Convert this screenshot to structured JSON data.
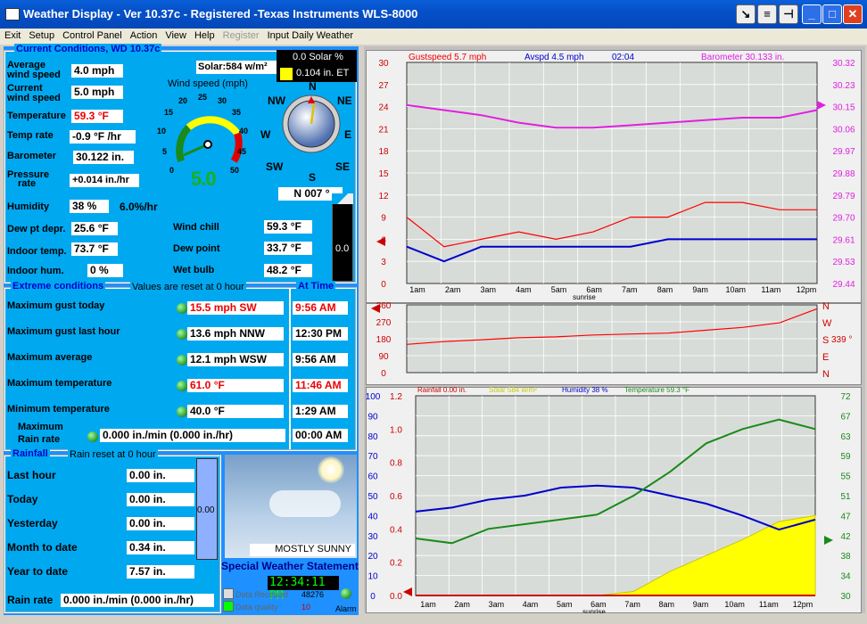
{
  "window": {
    "title": "Weather Display - Ver 10.37c - Registered  -Texas Instruments WLS-8000"
  },
  "menu": [
    {
      "l": "Exit",
      "d": false
    },
    {
      "l": "Setup",
      "d": false
    },
    {
      "l": "Control Panel",
      "d": false
    },
    {
      "l": "Action",
      "d": false
    },
    {
      "l": "View",
      "d": false
    },
    {
      "l": "Help",
      "d": false
    },
    {
      "l": "Register",
      "d": true
    },
    {
      "l": "Input Daily Weather",
      "d": false
    }
  ],
  "current": {
    "title": "Current Conditions, WD 10.37c",
    "avg_wind_label1": "Average",
    "avg_wind_label2": "wind speed",
    "avg_wind": "4.0 mph",
    "cur_wind_label1": "Current",
    "cur_wind_label2": "wind speed",
    "cur_wind": "5.0 mph",
    "temp_label": "Temperature",
    "temp": "59.3 °F",
    "temp_rate_label": "Temp rate",
    "temp_rate": "-0.9 °F /hr",
    "baro_label": "Barometer",
    "baro": "30.122 in.",
    "press_rate_label1": "Pressure",
    "press_rate_label2": "rate",
    "press_rate": "+0.014 in./hr",
    "humidity_label": "Humidity",
    "humidity": "38 %",
    "humidity_rate": "6.0%/hr",
    "dew_depr_label": "Dew pt depr.",
    "dew_depr": "25.6 °F",
    "indoor_temp_label": "Indoor temp.",
    "indoor_temp": "73.7 °F",
    "indoor_hum_label": "Indoor hum.",
    "indoor_hum": "0 %",
    "wind_chill_label": "Wind chill",
    "wind_chill": "59.3 °F",
    "dew_point_label": "Dew point",
    "dew_point": "33.7 °F",
    "wet_bulb_label": "Wet bulb",
    "wet_bulb": "48.2 °F",
    "solar": "Solar:584 w/m²",
    "solar_pct": "0.0 Solar %",
    "et": "0.104 in. ET",
    "wind_gauge_title": "Wind speed (mph)",
    "wind_gauge_ticks": [
      "0",
      "5",
      "10",
      "15",
      "20",
      "25",
      "30",
      "35",
      "40",
      "45",
      "50"
    ],
    "wind_gauge_value": "5.0",
    "compass": {
      "N": "N",
      "NE": "NE",
      "E": "E",
      "SE": "SE",
      "S": "S",
      "SW": "SW",
      "W": "W",
      "NW": "NW"
    },
    "wind_dir": "N  007 °",
    "meter_value": "0.0"
  },
  "extreme": {
    "title": "Extreme conditions",
    "note": "Values are reset at 0 hour",
    "at_time": "At Time",
    "rows": [
      {
        "label": "Maximum gust today",
        "value": "15.5 mph  SW",
        "time": "9:56 AM",
        "red": true
      },
      {
        "label": "Maximum gust last hour",
        "value": "13.6 mph NNW",
        "time": "12:30 PM",
        "red": false
      },
      {
        "label": "Maximum average",
        "value": "12.1 mph WSW",
        "time": "9:56 AM",
        "red": false
      },
      {
        "label": "Maximum temperature",
        "value": "61.0 °F",
        "time": "11:46 AM",
        "red": true
      },
      {
        "label": "Minimum temperature",
        "value": "40.0 °F",
        "time": "1:29 AM",
        "red": false
      }
    ],
    "max_rain_label1": "Maximum",
    "max_rain_label2": "Rain rate",
    "max_rain": "0.000 in./min (0.000 in./hr)",
    "max_rain_time": "00:00 AM"
  },
  "rainfall": {
    "title": "Rainfall",
    "note": "Rain reset at 0 hour",
    "rows": [
      {
        "label": "Last hour",
        "value": "0.00 in."
      },
      {
        "label": "Today",
        "value": "0.00 in."
      },
      {
        "label": "Yesterday",
        "value": "0.00 in."
      },
      {
        "label": "Month to date",
        "value": "0.34 in."
      },
      {
        "label": "Year to date",
        "value": "7.57 in."
      }
    ],
    "gauge_value": "0.00",
    "rate_label": "Rain rate",
    "rate": "0.000 in./min (0.000 in./hr)"
  },
  "sky": {
    "condition": "MOSTLY SUNNY",
    "statement": "Special Weather Statement",
    "time": "12:34:11 PM",
    "data_received_label": "Data Received",
    "data_received": "48276",
    "data_quality_label": "Data quality",
    "data_quality": "10",
    "alarm": "Alarm"
  },
  "x_ticks": [
    "1am",
    "2am",
    "3am",
    "4am",
    "5am",
    "6am",
    "7am",
    "8am",
    "9am",
    "10am",
    "11am",
    "12pm"
  ],
  "sunrise": "sunrise",
  "graph1": {
    "gust_label": "Gustspeed 5.7 mph",
    "avspd_label": "Avspd 4.5 mph",
    "time": "02:04",
    "baro_label": "Barometer    30.133 in.",
    "left_ticks": [
      "30",
      "27",
      "24",
      "21",
      "18",
      "15",
      "12",
      "9",
      "6",
      "3",
      "0"
    ],
    "right_ticks": [
      "30.32",
      "30.23",
      "30.15",
      "30.06",
      "29.97",
      "29.88",
      "29.79",
      "29.70",
      "29.61",
      "29.53",
      "29.44"
    ]
  },
  "graph2": {
    "left_ticks": [
      "360",
      "270",
      "180",
      "90",
      "0"
    ],
    "right_letters": [
      "N",
      "W",
      "S",
      "E",
      "N"
    ],
    "dir_label": "339 °"
  },
  "graph3": {
    "rain_label": "Rainfall   0.00 in.",
    "solar_label": "Solar  584 w/m²",
    "hum_label": "Humidity  38 %",
    "temp_label": "Temperature   59.3 °F",
    "l1_ticks": [
      "100",
      "90",
      "80",
      "70",
      "60",
      "50",
      "40",
      "30",
      "20",
      "10",
      "0"
    ],
    "l2_ticks": [
      "1.2",
      "1.0",
      "0.8",
      "0.6",
      "0.4",
      "0.2",
      "0.0"
    ],
    "right_ticks": [
      "72",
      "67",
      "63",
      "59",
      "55",
      "51",
      "47",
      "42",
      "38",
      "34",
      "30"
    ]
  },
  "colors": {
    "panel": "#00a8f0",
    "graph_bg": "#f0f0f0",
    "gust": "#ff0000",
    "avg": "#0000cc",
    "baro": "#e020e0",
    "temp": "#1a8a1a",
    "hum": "#0000cc",
    "solar": "#ffff00"
  },
  "chart_data": [
    {
      "type": "line",
      "title": "",
      "x": [
        "1am",
        "2am",
        "3am",
        "4am",
        "5am",
        "6am",
        "7am",
        "8am",
        "9am",
        "10am",
        "11am",
        "12pm"
      ],
      "ylim": [
        0,
        30
      ],
      "y2lim": [
        29.44,
        30.32
      ],
      "series": [
        {
          "name": "Gustspeed",
          "values": [
            9,
            5,
            6,
            7,
            6,
            7,
            9,
            9,
            11,
            11,
            10,
            10
          ]
        },
        {
          "name": "Avspd",
          "values": [
            5,
            3,
            5,
            5,
            5,
            5,
            5,
            6,
            6,
            6,
            6,
            6
          ]
        },
        {
          "name": "Barometer",
          "values": [
            30.15,
            30.13,
            30.11,
            30.08,
            30.06,
            30.06,
            30.07,
            30.08,
            30.09,
            30.1,
            30.1,
            30.13
          ]
        }
      ]
    },
    {
      "type": "line",
      "title": "",
      "x": [
        "1am",
        "2am",
        "3am",
        "4am",
        "5am",
        "6am",
        "7am",
        "8am",
        "9am",
        "10am",
        "11am",
        "12pm"
      ],
      "ylim": [
        0,
        360
      ],
      "series": [
        {
          "name": "Wind direction",
          "values": [
            150,
            165,
            175,
            185,
            190,
            200,
            205,
            210,
            225,
            240,
            265,
            339
          ]
        }
      ]
    },
    {
      "type": "area",
      "title": "",
      "x": [
        "1am",
        "2am",
        "3am",
        "4am",
        "5am",
        "6am",
        "7am",
        "8am",
        "9am",
        "10am",
        "11am",
        "12pm"
      ],
      "ylim": [
        0,
        100
      ],
      "y2lim": [
        30,
        72
      ],
      "series": [
        {
          "name": "Rainfall",
          "values": [
            0,
            0,
            0,
            0,
            0,
            0,
            0,
            0,
            0,
            0,
            0,
            0
          ]
        },
        {
          "name": "Solar",
          "values": [
            0,
            0,
            0,
            0,
            0,
            0,
            2,
            12,
            20,
            28,
            37,
            40
          ]
        },
        {
          "name": "Humidity",
          "values": [
            42,
            44,
            48,
            50,
            54,
            55,
            54,
            50,
            46,
            40,
            33,
            38
          ]
        },
        {
          "name": "Temperature",
          "values": [
            42,
            41,
            44,
            45,
            46,
            47,
            51,
            56,
            62,
            65,
            67,
            65
          ]
        }
      ]
    }
  ]
}
